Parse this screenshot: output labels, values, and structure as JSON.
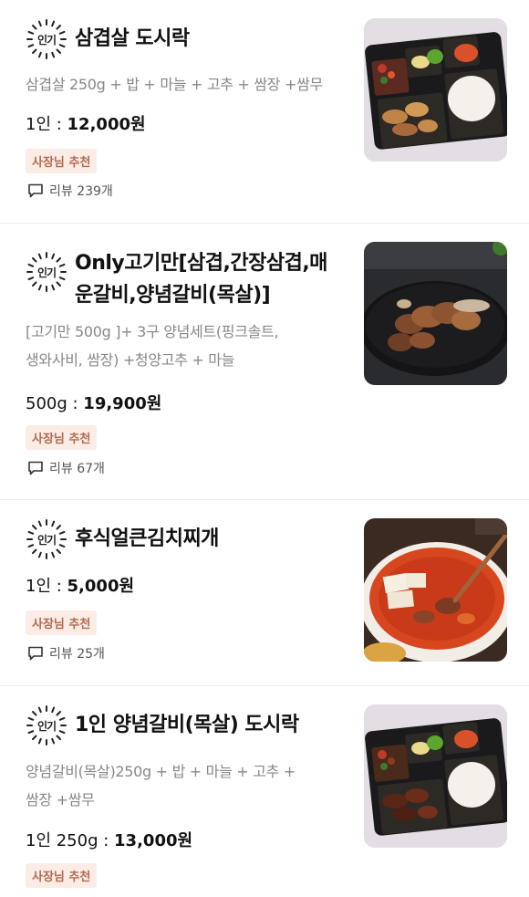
{
  "items": [
    {
      "badge": "인기",
      "title_lines": [
        "삼겹살 도시락"
      ],
      "desc_lines": [
        "삼겹살 250g + 밥 + 마늘 + 고추 + 쌈장 +쌈무"
      ],
      "price_unit": "1인 : ",
      "price": "12,000원",
      "tag": "사장님 추천",
      "review": "리뷰 239개",
      "image": "pork-belly-lunchbox-photo"
    },
    {
      "badge": "인기",
      "title_lines": [
        "Only고기만[삼겹,간장삼겹,매",
        "운갈비,양념갈비(목살)]"
      ],
      "desc_lines": [
        "[고기만 500g ]+  3구 양념세트(핑크솔트,",
        "생와사비, 쌈장) +청양고추 + 마늘"
      ],
      "price_unit": "500g : ",
      "price": "19,900원",
      "tag": "사장님 추천",
      "review": "리뷰 67개",
      "image": "grilled-meat-plate-photo"
    },
    {
      "badge": "인기",
      "title_lines": [
        "후식얼큰김치찌개"
      ],
      "desc_lines": [],
      "price_unit": "1인 : ",
      "price": "5,000원",
      "tag": "사장님 추천",
      "review": "리뷰 25개",
      "image": "kimchi-stew-photo"
    },
    {
      "badge": "인기",
      "title_lines": [
        "1인 양념갈비(목살) 도시락"
      ],
      "desc_lines": [
        "양념갈비(목살)250g + 밥  + 마늘 + 고추 +",
        "쌈장 +쌈무"
      ],
      "price_unit": "1인 250g : ",
      "price": "13,000원",
      "tag": "사장님 추천",
      "review": "",
      "image": "marinated-rib-lunchbox-photo"
    }
  ],
  "colors": {
    "tag_bg": "#fbece6",
    "tag_text": "#b16b52",
    "desc_text": "#888888",
    "divider": "#ececec"
  }
}
